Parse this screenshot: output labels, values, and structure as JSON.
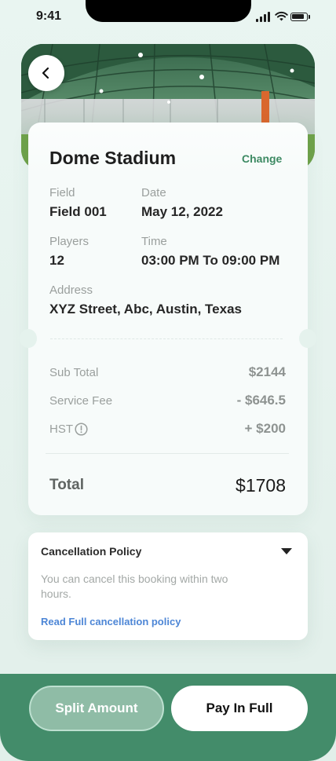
{
  "status_bar": {
    "time": "9:41"
  },
  "header": {
    "back_icon": "chevron-left-icon"
  },
  "booking": {
    "venue_name": "Dome Stadium",
    "change_label": "Change",
    "field_label": "Field",
    "field_value": "Field 001",
    "date_label": "Date",
    "date_value": "May 12, 2022",
    "players_label": "Players",
    "players_value": "12",
    "time_label": "Time",
    "time_value": "03:00 PM To 09:00 PM",
    "address_label": "Address",
    "address_value": "XYZ Street, Abc, Austin, Texas"
  },
  "pricing": {
    "subtotal_label": "Sub Total",
    "subtotal_value": "$2144",
    "service_fee_label": "Service Fee",
    "service_fee_value": "- $646.5",
    "hst_label": "HST",
    "hst_icon": "info-icon",
    "hst_value": "+ $200",
    "total_label": "Total",
    "total_value": "$1708"
  },
  "cancellation": {
    "title": "Cancellation Policy",
    "text": "You can cancel this booking within two hours.",
    "link": "Read Full cancellation policy"
  },
  "actions": {
    "split_label": "Split Amount",
    "pay_label": "Pay In Full"
  },
  "colors": {
    "brand_green": "#438c6a",
    "change_link": "#3d8a63",
    "policy_link": "#4d86d6"
  }
}
